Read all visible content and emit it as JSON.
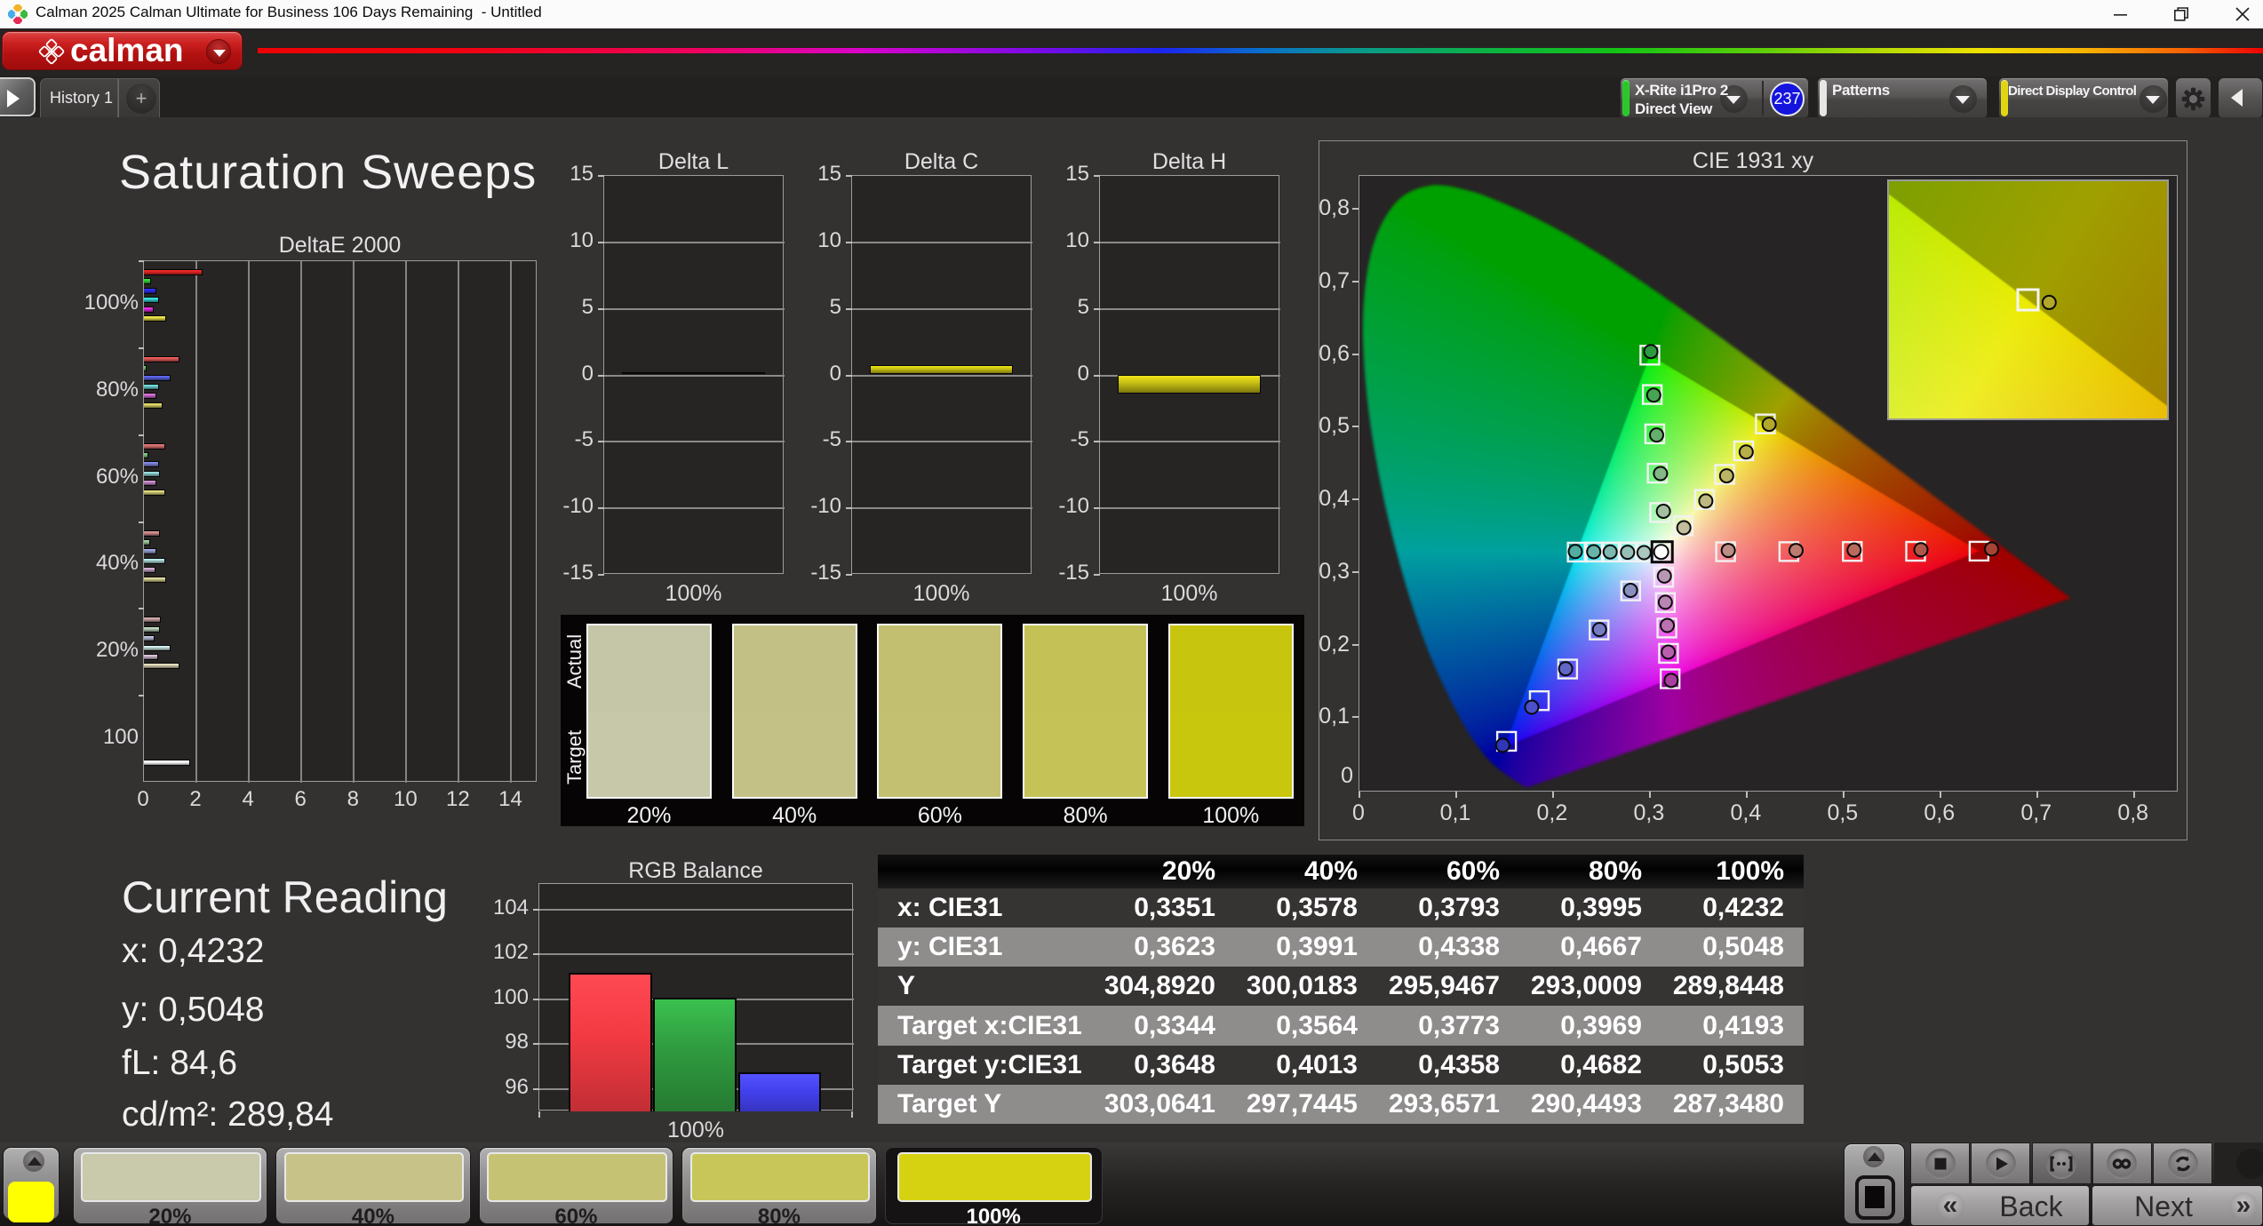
{
  "window": {
    "title": "Calman 2025 Calman Ultimate for Business 106 Days Remaining  - Untitled",
    "controls": {
      "minimize": "minimize",
      "restore": "restore",
      "close": "close"
    }
  },
  "brand": {
    "logo_word": "calman"
  },
  "tabs": {
    "history": "History 1",
    "add": "+"
  },
  "toolbar": {
    "meter": {
      "line1": "X-Rite i1Pro 2",
      "line2": "Direct View",
      "badge": "237",
      "accent": "#28c828"
    },
    "patterns": {
      "label": "Patterns",
      "accent": "#e6e6e6"
    },
    "display_control": {
      "label": "Direct Display Control",
      "accent": "#e0d50e"
    }
  },
  "page": {
    "title": "Saturation Sweeps"
  },
  "current_reading": {
    "title": "Current Reading",
    "lines": [
      {
        "label": "x:",
        "value": "0,4232"
      },
      {
        "label": "y:",
        "value": "0,5048"
      },
      {
        "label": "fL:",
        "value": "84,6"
      },
      {
        "label": "cd/m²:",
        "value": "289,84"
      }
    ]
  },
  "saturation_swatches": {
    "row_labels": [
      "Actual",
      "Target"
    ],
    "columns": [
      "20%",
      "40%",
      "60%",
      "80%",
      "100%"
    ],
    "actual_colors": [
      "#c5c5a8",
      "#c3c086",
      "#c2bf70",
      "#c4c257",
      "#c8c50e"
    ],
    "target_colors": [
      "#c7c7a9",
      "#c4c187",
      "#c3c071",
      "#c5c357",
      "#c9c60e"
    ]
  },
  "bottom_bar": {
    "patterns": [
      {
        "label": "20%",
        "color": "#c9c9ab",
        "selected": false
      },
      {
        "label": "40%",
        "color": "#c7c388",
        "selected": false
      },
      {
        "label": "60%",
        "color": "#c6c273",
        "selected": false
      },
      {
        "label": "80%",
        "color": "#c8c659",
        "selected": false
      },
      {
        "label": "100%",
        "color": "#d6d211",
        "selected": true
      }
    ],
    "quick_color": "#ffff00",
    "transport": [
      "stop",
      "play",
      "range",
      "infinity",
      "refresh"
    ],
    "back_label": "Back",
    "next_label": "Next",
    "back_icon": "«",
    "next_icon": "»"
  },
  "chart_data": [
    {
      "id": "deltae2000",
      "type": "bar",
      "orientation": "horizontal",
      "title": "DeltaE 2000",
      "xlim": [
        0,
        15
      ],
      "xticks": [
        0,
        2,
        4,
        6,
        8,
        10,
        12,
        14
      ],
      "groups": [
        {
          "label": "100%",
          "values": [
            2.23,
            0.28,
            0.49,
            0.57,
            0.38,
            0.85
          ],
          "colors": [
            "#d42222",
            "#2ec22e",
            "#2a2ad8",
            "#2ec4c4",
            "#cc26cc",
            "#d2ca3e"
          ]
        },
        {
          "label": "80%",
          "values": [
            1.35,
            0.1,
            1.0,
            0.57,
            0.46,
            0.71
          ],
          "colors": [
            "#cc5050",
            "#5cb85c",
            "#5058cc",
            "#62bcbc",
            "#bc62bc",
            "#c6c05c"
          ]
        },
        {
          "label": "60%",
          "values": [
            0.82,
            0.17,
            0.57,
            0.6,
            0.46,
            0.82
          ],
          "colors": [
            "#c46666",
            "#74b274",
            "#7078c4",
            "#82c0c0",
            "#b67eb6",
            "#c4be6e"
          ]
        },
        {
          "label": "40%",
          "values": [
            0.6,
            0.23,
            0.46,
            0.82,
            0.45,
            0.86
          ],
          "colors": [
            "#bc7e7e",
            "#8cb88c",
            "#8c92c2",
            "#9ecaca",
            "#b696b6",
            "#c2be88"
          ]
        },
        {
          "label": "20%",
          "values": [
            0.66,
            0.6,
            0.42,
            1.03,
            0.54,
            1.35
          ],
          "colors": [
            "#b89494",
            "#a8bea8",
            "#a4a8c0",
            "#b6d0cc",
            "#bca8bc",
            "#c6c2a4"
          ]
        },
        {
          "label": "100",
          "values": [
            1.77
          ],
          "slot": 6,
          "colors": [
            "#f4f4f4"
          ]
        }
      ]
    },
    {
      "id": "deltaL",
      "type": "bar",
      "title": "Delta L",
      "ylim": [
        -15,
        15
      ],
      "yticks": [
        15,
        10,
        5,
        0,
        -5,
        -10,
        -15
      ],
      "categories": [
        "100%"
      ],
      "values": [
        0.15
      ],
      "bar_color": "#c8c014"
    },
    {
      "id": "deltaC",
      "type": "bar",
      "title": "Delta C",
      "ylim": [
        -15,
        15
      ],
      "yticks": [
        15,
        10,
        5,
        0,
        -5,
        -10,
        -15
      ],
      "categories": [
        "100%"
      ],
      "values": [
        0.72
      ],
      "bar_color": "#c8c014"
    },
    {
      "id": "deltaH",
      "type": "bar",
      "title": "Delta H",
      "ylim": [
        -15,
        15
      ],
      "yticks": [
        15,
        10,
        5,
        0,
        -5,
        -10,
        -15
      ],
      "categories": [
        "100%"
      ],
      "values": [
        -1.45
      ],
      "bar_color": "#c8c014"
    },
    {
      "id": "cie",
      "type": "scatter",
      "title": "CIE 1931 xy",
      "xlim": [
        0,
        0.8443
      ],
      "ylim": [
        0,
        0.847
      ],
      "xticks": [
        "0",
        "0,1",
        "0,2",
        "0,3",
        "0,4",
        "0,5",
        "0,6",
        "0,7",
        "0,8"
      ],
      "yticks": [
        "0,1",
        "0,2",
        "0,3",
        "0,4",
        "0,5",
        "0,6",
        "0,7",
        "0,8"
      ],
      "corner_label": "0",
      "white_point": {
        "target": [
          0.3127,
          0.329
        ],
        "measured": [
          0.3117,
          0.329
        ]
      },
      "gamut": {
        "red": [
          0.64,
          0.33
        ],
        "green": [
          0.3,
          0.6
        ],
        "blue": [
          0.15,
          0.06
        ]
      },
      "sweeps": [
        {
          "name": "red",
          "targets": [
            [
              0.3782,
              0.3292
            ],
            [
              0.4436,
              0.3294
            ],
            [
              0.5091,
              0.3296
            ],
            [
              0.5745,
              0.3298
            ],
            [
              0.64,
              0.33
            ]
          ],
          "measured": [
            [
              0.381,
              0.331
            ],
            [
              0.451,
              0.331
            ],
            [
              0.511,
              0.3315
            ],
            [
              0.58,
              0.332
            ],
            [
              0.653,
              0.333
            ]
          ],
          "colors": [
            "#bc8c85",
            "#bc7b6f",
            "#b96a5c",
            "#b25648",
            "#a84335"
          ]
        },
        {
          "name": "green",
          "targets": [
            [
              0.3102,
              0.3832
            ],
            [
              0.3076,
              0.4374
            ],
            [
              0.3051,
              0.4916
            ],
            [
              0.3025,
              0.5458
            ],
            [
              0.3,
              0.6
            ]
          ],
          "measured": [
            [
              0.314,
              0.385
            ],
            [
              0.311,
              0.437
            ],
            [
              0.307,
              0.49
            ],
            [
              0.304,
              0.545
            ],
            [
              0.301,
              0.605
            ]
          ],
          "colors": [
            "#a3bfa0",
            "#83b785",
            "#65ae6b",
            "#48a455",
            "#2c9a40"
          ]
        },
        {
          "name": "blue",
          "targets": [
            [
              0.2802,
              0.2752
            ],
            [
              0.2476,
              0.2214
            ],
            [
              0.2151,
              0.1676
            ],
            [
              0.1858,
              0.124
            ],
            [
              0.152,
              0.068
            ]
          ],
          "measured": [
            [
              0.28,
              0.276
            ],
            [
              0.248,
              0.222
            ],
            [
              0.213,
              0.168
            ],
            [
              0.178,
              0.115
            ],
            [
              0.148,
              0.0625
            ]
          ],
          "colors": [
            "#8a90bd",
            "#757cc2",
            "#6067c6",
            "#4b51ca",
            "#3036b8"
          ]
        },
        {
          "name": "cyan",
          "targets": [
            [
              0.2952,
              0.3289
            ],
            [
              0.2776,
              0.3289
            ],
            [
              0.2601,
              0.3288
            ],
            [
              0.2425,
              0.3288
            ],
            [
              0.225,
              0.3287
            ]
          ],
          "measured": [
            [
              0.294,
              0.328
            ],
            [
              0.277,
              0.3285
            ],
            [
              0.259,
              0.329
            ],
            [
              0.242,
              0.3293
            ],
            [
              0.223,
              0.3295
            ]
          ],
          "colors": [
            "#aac6bf",
            "#94c0b8",
            "#7db9b0",
            "#67b3a8",
            "#50ada0"
          ]
        },
        {
          "name": "magenta",
          "targets": [
            [
              0.3143,
              0.294
            ],
            [
              0.316,
              0.2591
            ],
            [
              0.3176,
              0.2241
            ],
            [
              0.3193,
              0.1892
            ],
            [
              0.3209,
              0.1542
            ]
          ],
          "measured": [
            [
              0.315,
              0.2957
            ],
            [
              0.316,
              0.2596
            ],
            [
              0.318,
              0.2276
            ],
            [
              0.319,
              0.191
            ],
            [
              0.322,
              0.152
            ]
          ],
          "colors": [
            "#b897b4",
            "#b985b2",
            "#ba72b0",
            "#ba5fae",
            "#a93f9e"
          ]
        },
        {
          "name": "yellow",
          "targets": [
            [
              0.3344,
              0.3648
            ],
            [
              0.3564,
              0.4013
            ],
            [
              0.3773,
              0.4358
            ],
            [
              0.3969,
              0.4682
            ],
            [
              0.4193,
              0.5053
            ]
          ],
          "measured": [
            [
              0.3351,
              0.3623
            ],
            [
              0.3578,
              0.3991
            ],
            [
              0.3793,
              0.4338
            ],
            [
              0.3995,
              0.4667
            ],
            [
              0.4232,
              0.5048
            ]
          ],
          "colors": [
            "#c1bd9d",
            "#bfb981",
            "#bcb465",
            "#b8ae4a",
            "#b2a82b"
          ]
        }
      ],
      "inset": {
        "x_range": [
          0.3937,
          0.4449
        ],
        "y_range": [
          0.4825,
          0.5281
        ],
        "target": [
          0.4193,
          0.5053
        ],
        "measured": [
          0.4232,
          0.5048
        ],
        "measured_color": "#b2a82b"
      }
    },
    {
      "id": "rgb_balance",
      "type": "bar",
      "title": "RGB Balance",
      "categories": [
        "Red",
        "Green",
        "Blue"
      ],
      "values": [
        101.18,
        100.06,
        96.73
      ],
      "colors": [
        "#f23a42",
        "#2f9a3f",
        "#4341ee"
      ],
      "ylim": [
        95,
        105.13
      ],
      "yticks": [
        104,
        102,
        100,
        98,
        96
      ],
      "xlabel": "100%"
    },
    {
      "id": "measurement_table",
      "type": "table",
      "columns": [
        "20%",
        "40%",
        "60%",
        "80%",
        "100%"
      ],
      "rows": [
        {
          "label": "x: CIE31",
          "values": [
            "0,3351",
            "0,3578",
            "0,3793",
            "0,3995",
            "0,4232"
          ]
        },
        {
          "label": "y: CIE31",
          "values": [
            "0,3623",
            "0,3991",
            "0,4338",
            "0,4667",
            "0,5048"
          ]
        },
        {
          "label": "Y",
          "values": [
            "304,8920",
            "300,0183",
            "295,9467",
            "293,0009",
            "289,8448"
          ]
        },
        {
          "label": "Target x:CIE31",
          "values": [
            "0,3344",
            "0,3564",
            "0,3773",
            "0,3969",
            "0,4193"
          ]
        },
        {
          "label": "Target y:CIE31",
          "values": [
            "0,3648",
            "0,4013",
            "0,4358",
            "0,4682",
            "0,5053"
          ]
        },
        {
          "label": "Target Y",
          "values": [
            "303,0641",
            "297,7445",
            "293,6571",
            "290,4493",
            "287,3480"
          ]
        }
      ]
    }
  ]
}
